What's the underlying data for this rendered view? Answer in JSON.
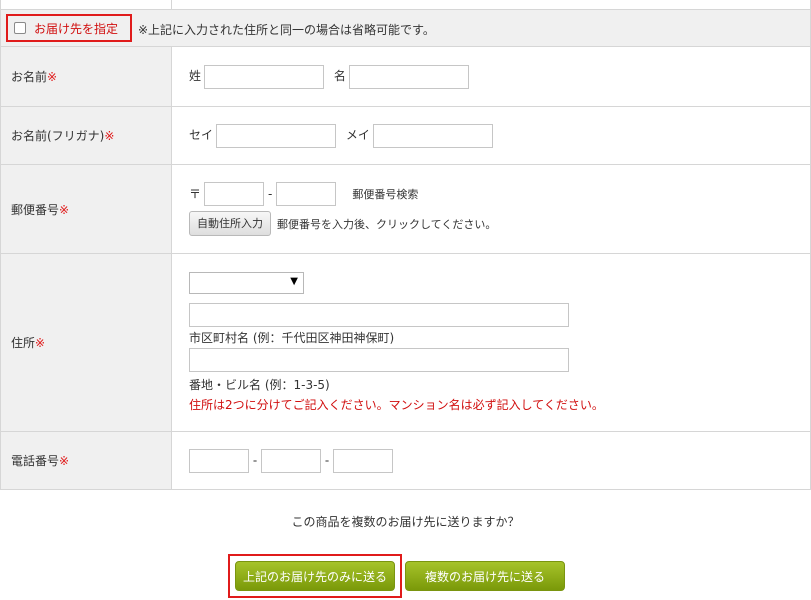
{
  "deliver": {
    "toggle_label": "お届け先を指定",
    "note": "※上記に入力された住所と同一の場合は省略可能です。"
  },
  "required_mark": "※",
  "name": {
    "label": "お名前",
    "last_label": "姓",
    "first_label": "名",
    "last_value": "",
    "first_value": ""
  },
  "kana": {
    "label": "お名前(フリガナ)",
    "last_label": "セイ",
    "first_label": "メイ",
    "last_value": "",
    "first_value": ""
  },
  "postal": {
    "label": "郵便番号",
    "mark": "〒",
    "sep": "-",
    "search_link": "郵便番号検索",
    "auto_button": "自動住所入力",
    "auto_hint": "郵便番号を入力後、クリックしてください。",
    "first_value": "",
    "second_value": ""
  },
  "address": {
    "label": "住所",
    "prefecture_selected": "",
    "city_value": "",
    "city_example": "市区町村名 (例：千代田区神田神保町)",
    "street_value": "",
    "street_example": "番地・ビル名 (例：1-3-5)",
    "warning": "住所は2つに分けてご記入ください。マンション名は必ず記入してください。"
  },
  "phone": {
    "label": "電話番号",
    "sep": "-",
    "part1": "",
    "part2": "",
    "part3": ""
  },
  "multi": {
    "question": "この商品を複数のお届け先に送りますか？",
    "single_button": "上記のお届け先のみに送る",
    "multi_button": "複数のお届け先に送る"
  },
  "colors": {
    "required": "#e01b1b",
    "button_green": "#8fae1b",
    "highlight_border": "#e01b1b"
  }
}
